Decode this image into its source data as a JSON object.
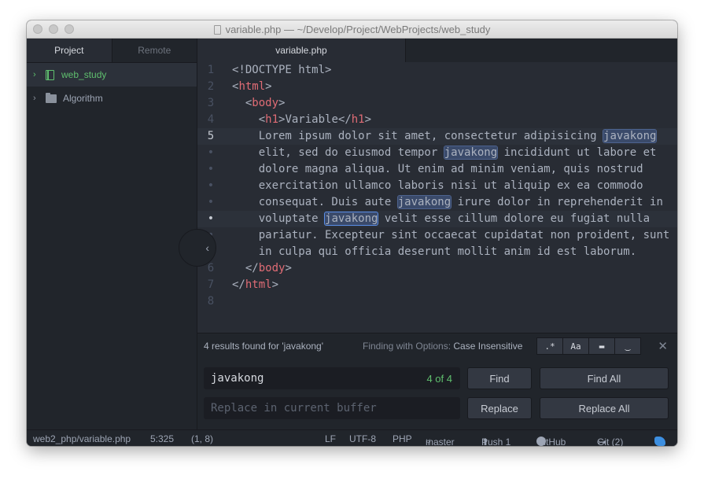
{
  "window": {
    "title": "variable.php — ~/Develop/Project/WebProjects/web_study"
  },
  "panel": {
    "tabs": [
      "Project",
      "Remote"
    ],
    "tree": [
      {
        "label": "web_study",
        "icon": "repo-icon",
        "selected": true
      },
      {
        "label": "Algorithm",
        "icon": "folder-icon",
        "selected": false
      }
    ]
  },
  "editor": {
    "tab": "variable.php",
    "gutter": [
      "1",
      "2",
      "3",
      "4",
      "5",
      "•",
      "•",
      "•",
      "•",
      "•",
      "•",
      "•",
      "6",
      "7",
      "8"
    ],
    "lines": [
      "<!DOCTYPE html>",
      "<html>",
      "  <body>",
      "    <h1>Variable</h1>",
      "    Lorem ipsum dolor sit amet, consectetur adipisicing javakong",
      "    elit, sed do eiusmod tempor javakong incididunt ut labore et",
      "    dolore magna aliqua. Ut enim ad minim veniam, quis nostrud",
      "    exercitation ullamco laboris nisi ut aliquip ex ea commodo",
      "    consequat. Duis aute javakong irure dolor in reprehenderit in",
      "    voluptate javakong velit esse cillum dolore eu fugiat nulla",
      "    pariatur. Excepteur sint occaecat cupidatat non proident, sunt",
      "    in culpa qui officia deserunt mollit anim id est laborum.",
      "  </body>",
      "</html>",
      ""
    ],
    "search_term": "javakong",
    "current_match_line": 9
  },
  "find": {
    "results": "4 results found for 'javakong'",
    "options_prefix": "Finding with Options: ",
    "options_value": "Case Insensitive",
    "option_buttons": [
      ".*",
      "Aa",
      "▬",
      "‿"
    ],
    "find_value": "javakong",
    "match_count": "4 of 4",
    "replace_placeholder": "Replace in current buffer",
    "find_btn": "Find",
    "find_all_btn": "Find All",
    "replace_btn": "Replace",
    "replace_all_btn": "Replace All"
  },
  "status": {
    "path": "web2_php/variable.php",
    "cursor": "5:325",
    "selection": "(1, 8)",
    "line_ending": "LF",
    "encoding": "UTF-8",
    "grammar": "PHP",
    "branch": "master",
    "push": "Push 1",
    "github": "GitHub",
    "git": "Git (2)"
  }
}
